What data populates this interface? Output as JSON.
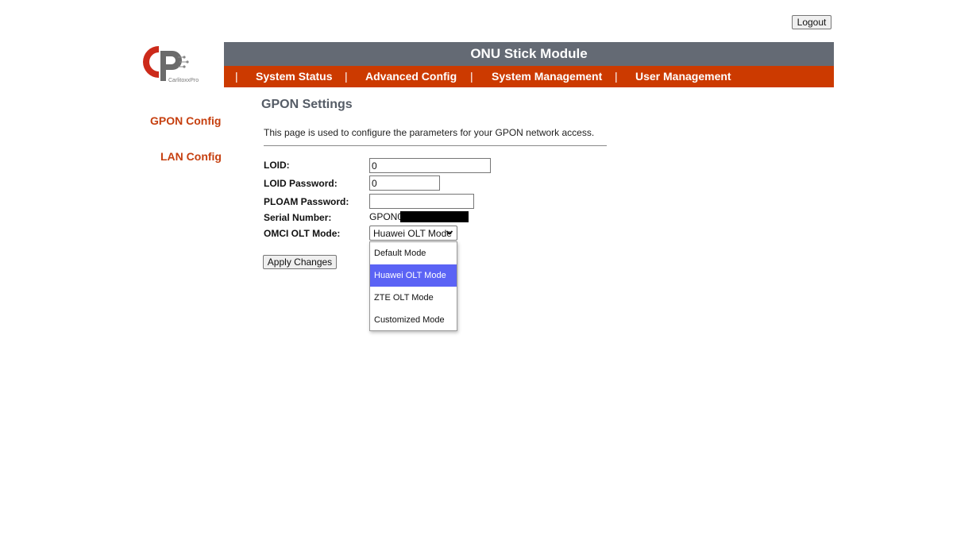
{
  "header": {
    "logout_label": "Logout",
    "title": "ONU Stick Module",
    "brand_name": "CarlitoxxPro"
  },
  "nav": {
    "separator": "|",
    "items": [
      {
        "label": "System Status"
      },
      {
        "label": "Advanced Config"
      },
      {
        "label": "System Management"
      },
      {
        "label": "User Management"
      }
    ]
  },
  "sidebar": {
    "items": [
      {
        "label": "GPON Config"
      },
      {
        "label": "LAN Config"
      }
    ]
  },
  "main": {
    "title": "GPON Settings",
    "description": "This page is used to configure the parameters for your GPON network access.",
    "form": {
      "loid": {
        "label": "LOID:",
        "value": "0"
      },
      "loid_password": {
        "label": "LOID Password:",
        "value": "0"
      },
      "ploam_password": {
        "label": "PLOAM Password:",
        "value": ""
      },
      "serial_number": {
        "label": "Serial Number:",
        "value": "GPON0"
      },
      "omci_olt_mode": {
        "label": "OMCI OLT Mode:",
        "value": "Huawei OLT Mode",
        "options": [
          "Default Mode",
          "Huawei OLT Mode",
          "ZTE OLT Mode",
          "Customized Mode"
        ],
        "selected_index": 1
      }
    },
    "apply_label": "Apply Changes"
  },
  "colors": {
    "title_bar": "#646a74",
    "nav_bar": "#cc3a00",
    "sidebar_link": "#c64010",
    "selected_option": "#5b63f5"
  }
}
